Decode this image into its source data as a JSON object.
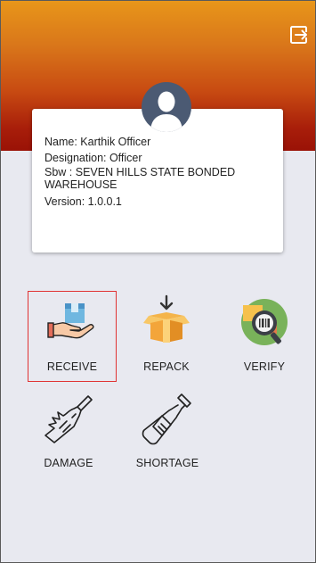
{
  "profile": {
    "name_line": "Name: Karthik Officer",
    "designation_line": "Designation: Officer",
    "sbw_line": "Sbw : SEVEN HILLS STATE BONDED WAREHOUSE",
    "version_line": "Version: 1.0.0.1"
  },
  "menu": {
    "tiles": [
      {
        "label": "RECEIVE",
        "icon": "receive-box-hand-icon",
        "selected": true
      },
      {
        "label": "REPACK",
        "icon": "repack-box-icon",
        "selected": false
      },
      {
        "label": "VERIFY",
        "icon": "verify-barcode-icon",
        "selected": false
      },
      {
        "label": "DAMAGE",
        "icon": "broken-bottle-icon",
        "selected": false
      },
      {
        "label": "SHORTAGE",
        "icon": "bottle-icon",
        "selected": false
      }
    ]
  },
  "colors": {
    "header_top": "#e8961a",
    "header_bottom": "#9a1206",
    "avatar": "#4b5a73",
    "selected_outline": "#e03333"
  }
}
